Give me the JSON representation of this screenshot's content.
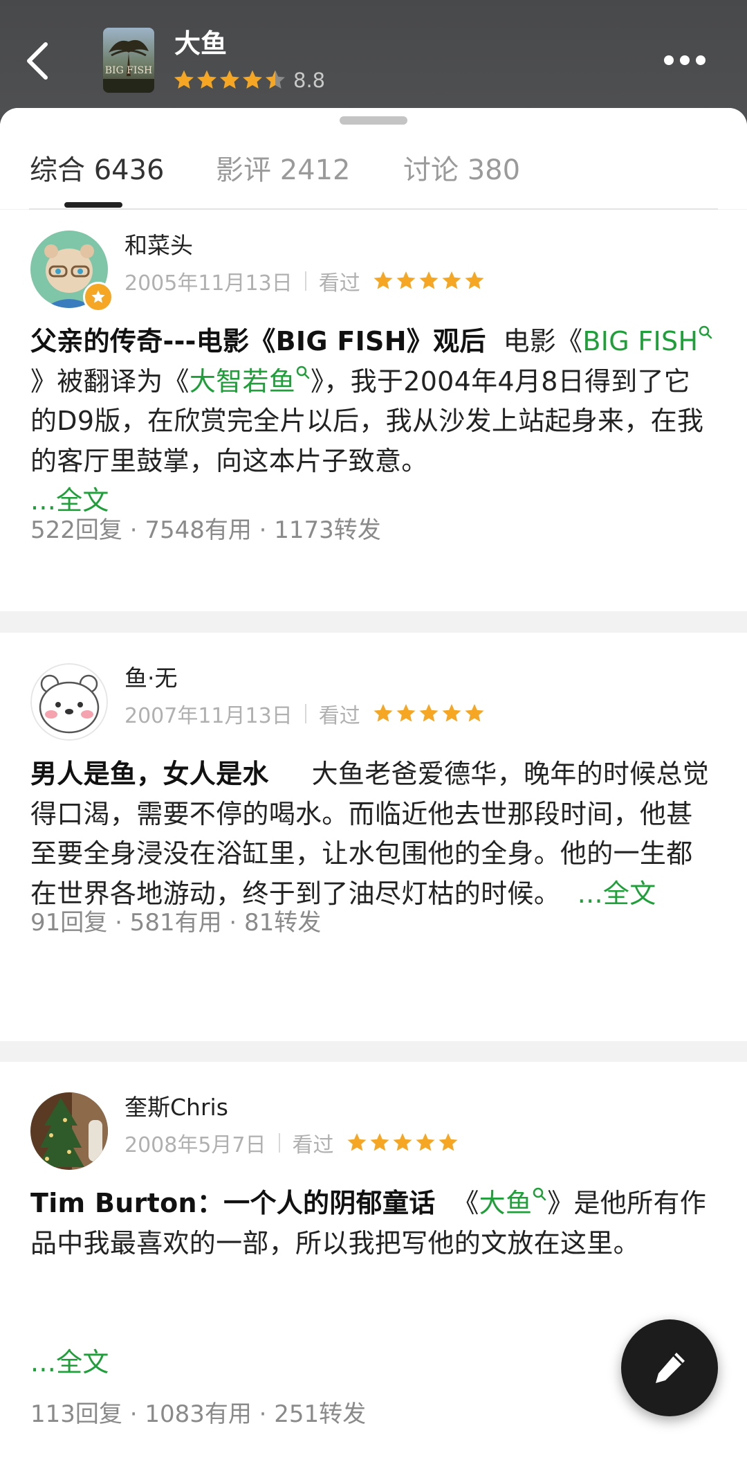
{
  "header": {
    "title": "大鱼",
    "poster_text": "BIG FISH",
    "rating_stars": 4.5,
    "score": "8.8"
  },
  "tabs": [
    {
      "label": "综合 6436",
      "active": true
    },
    {
      "label": "影评 2412",
      "active": false
    },
    {
      "label": "讨论 380",
      "active": false
    }
  ],
  "reviews": [
    {
      "username": "和菜头",
      "date": "2005年11月13日",
      "status": "看过",
      "stars": 5,
      "title": "父亲的传奇---电影《BIG FISH》观后",
      "body_pre": "电影《",
      "link1": "BIG FISH",
      "body_mid": "》被翻译为《",
      "link2": "大智若鱼",
      "body_post": "》，我于2004年4月8日得到了它的D9版，在欣赏完全片以后，我从沙发上站起身来，在我的客厅里鼓掌，向这本片子致意。",
      "more": "...全文",
      "stats": "522回复 · 7548有用 · 1173转发"
    },
    {
      "username": "鱼·无",
      "date": "2007年11月13日",
      "status": "看过",
      "stars": 5,
      "title": "男人是鱼，女人是水",
      "body": "大鱼老爸爱德华，晚年的时候总觉得口渴，需要不停的喝水。而临近他去世那段时间，他甚至要全身浸没在浴缸里，让水包围他的全身。他的一生都在世界各地游动，终于到了油尽灯枯的时候。",
      "more": "...全文",
      "stats": "91回复 · 581有用 · 81转发"
    },
    {
      "username": "奎斯Chris",
      "date": "2008年5月7日",
      "status": "看过",
      "stars": 5,
      "title": "Tim Burton：一个人的阴郁童话",
      "body_pre": "《",
      "link1": "大鱼",
      "body_post": "》是他所有作品中我最喜欢的一部，所以我把写他的文放在这里。",
      "more": "...全文",
      "stats": "113回复 · 1083有用 · 251转发"
    }
  ],
  "colors": {
    "header_bg": "#4a4b4d",
    "star": "#f5a623",
    "link": "#1f9f39",
    "fab_bg": "#1c1c1c"
  },
  "icons": [
    "back-icon",
    "more-icon",
    "star-icon",
    "search-icon",
    "pencil-icon",
    "badge-icon"
  ]
}
